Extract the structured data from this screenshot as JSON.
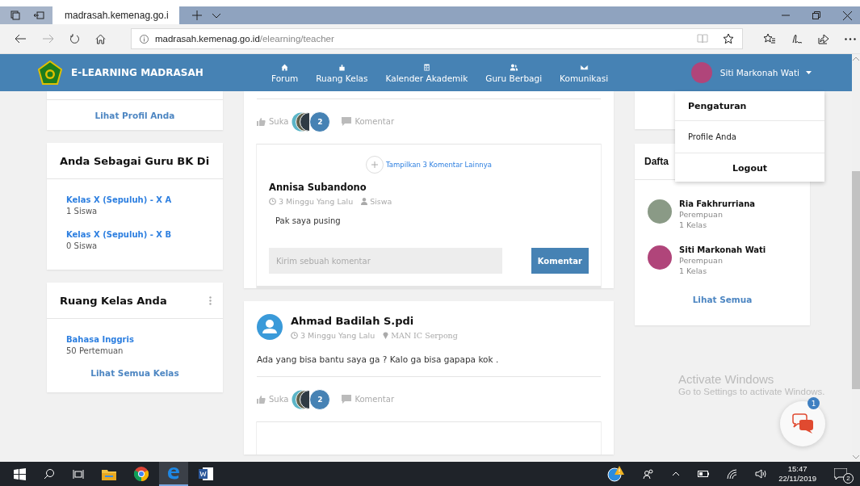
{
  "browser": {
    "tab_title": "madrasah.kemenag.go.i",
    "url_host": "madrasah.kemenag.go.id",
    "url_path": "/elearning/teacher"
  },
  "navbar": {
    "brand": "E-LEARNING MADRASAH",
    "menu": [
      {
        "label": "Forum"
      },
      {
        "label": "Ruang Kelas"
      },
      {
        "label": "Kalender Akademik"
      },
      {
        "label": "Guru Berbagi"
      },
      {
        "label": "Komunikasi"
      }
    ],
    "user": {
      "name": "Siti Markonah Wati",
      "menu_open": true
    }
  },
  "user_menu": {
    "title": "Pengaturan",
    "items": [
      "Profile Anda"
    ],
    "logout": "Logout"
  },
  "left": {
    "profile_link": "Lihat Profil Anda",
    "bk_card": {
      "title": "Anda Sebagai Guru BK Di",
      "classes": [
        {
          "name": "Kelas X (Sepuluh) - X A",
          "count": "1 Siswa"
        },
        {
          "name": "Kelas X (Sepuluh) - X B",
          "count": "0 Siswa"
        }
      ]
    },
    "class_card": {
      "title": "Ruang Kelas Anda",
      "classes": [
        {
          "name": "Bahasa Inggris",
          "count": "50 Pertemuan"
        }
      ],
      "link": "Lihat Semua Kelas"
    }
  },
  "feed": [
    {
      "likes": {
        "label": "Suka",
        "count": "2"
      },
      "comment_label": "Komentar",
      "comments": {
        "more": "Tampilkan 3 Komentar Lainnya",
        "items": [
          {
            "name": "Annisa Subandono",
            "time": "3 Minggu Yang Lalu",
            "role": "Siswa",
            "text": "Pak saya pusing"
          }
        ],
        "input_placeholder": "Kirim sebuah komentar",
        "submit": "Komentar"
      }
    },
    {
      "author": "Ahmad Badilah S.pdi",
      "time": "3 Minggu Yang Lalu",
      "location": "MAN IC Serpong",
      "text": "Ada yang bisa bantu saya ga ? Kalo ga bisa gapapa kok .",
      "likes": {
        "label": "Suka",
        "count": "2"
      },
      "comment_label": "Komentar"
    }
  ],
  "right": {
    "list_title": "Dafta",
    "people": [
      {
        "name": "Ria Fakhrurriana",
        "gender": "Perempuan",
        "classes": "1 Kelas"
      },
      {
        "name": "Siti Markonah Wati",
        "gender": "Perempuan",
        "classes": "1 Kelas"
      }
    ],
    "link": "Lihat Semua"
  },
  "activation": {
    "title": "Activate Windows",
    "text": "Go to Settings to activate Windows."
  },
  "chat": {
    "badge": "1"
  },
  "taskbar": {
    "time": "15:47",
    "date": "22/11/2019",
    "notifications": "2"
  }
}
